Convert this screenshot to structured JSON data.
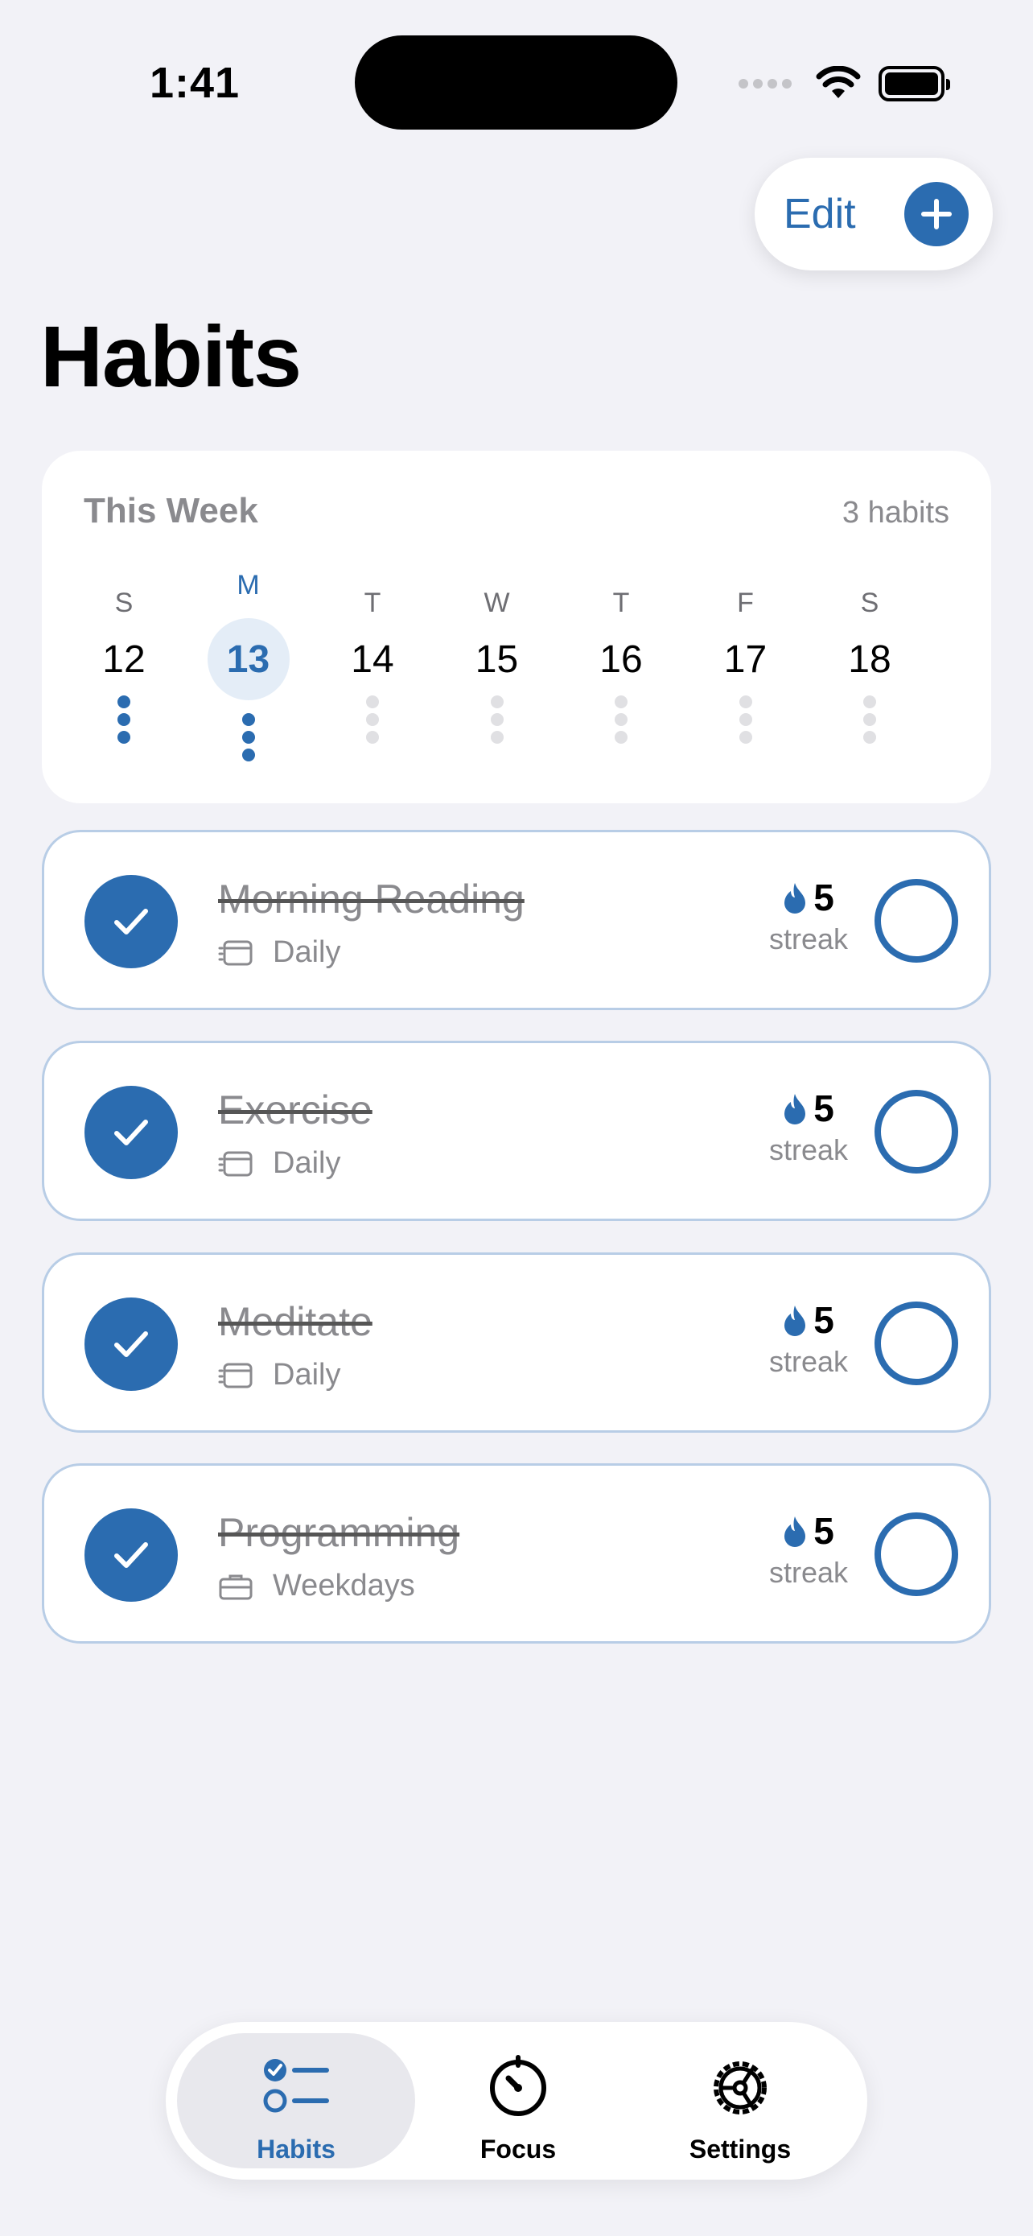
{
  "status_bar": {
    "time": "1:41"
  },
  "toolbar": {
    "edit_label": "Edit"
  },
  "page": {
    "title": "Habits"
  },
  "week": {
    "title": "This Week",
    "count": "3 habits",
    "days": [
      {
        "letter": "S",
        "num": "12",
        "active": false,
        "dots": 3,
        "dots_done": true
      },
      {
        "letter": "M",
        "num": "13",
        "active": true,
        "dots": 3,
        "dots_done": true
      },
      {
        "letter": "T",
        "num": "14",
        "active": false,
        "dots": 3,
        "dots_done": false
      },
      {
        "letter": "W",
        "num": "15",
        "active": false,
        "dots": 3,
        "dots_done": false
      },
      {
        "letter": "T",
        "num": "16",
        "active": false,
        "dots": 3,
        "dots_done": false
      },
      {
        "letter": "F",
        "num": "17",
        "active": false,
        "dots": 3,
        "dots_done": false
      },
      {
        "letter": "S",
        "num": "18",
        "active": false,
        "dots": 3,
        "dots_done": false
      }
    ]
  },
  "habits": [
    {
      "name": "Morning Reading",
      "frequency": "Daily",
      "freq_icon": "calendar-icon",
      "streak": "5",
      "streak_label": "streak",
      "completed": true
    },
    {
      "name": "Exercise",
      "frequency": "Daily",
      "freq_icon": "calendar-icon",
      "streak": "5",
      "streak_label": "streak",
      "completed": true
    },
    {
      "name": "Meditate",
      "frequency": "Daily",
      "freq_icon": "calendar-icon",
      "streak": "5",
      "streak_label": "streak",
      "completed": true
    },
    {
      "name": "Programming",
      "frequency": "Weekdays",
      "freq_icon": "briefcase-icon",
      "streak": "5",
      "streak_label": "streak",
      "completed": true
    }
  ],
  "tabbar": {
    "tabs": [
      {
        "label": "Habits",
        "icon": "checklist-icon",
        "active": true
      },
      {
        "label": "Focus",
        "icon": "timer-icon",
        "active": false
      },
      {
        "label": "Settings",
        "icon": "gear-icon",
        "active": false
      }
    ]
  },
  "colors": {
    "accent": "#2b6cb0",
    "background": "#f2f2f7",
    "muted": "#8a8a8e"
  }
}
